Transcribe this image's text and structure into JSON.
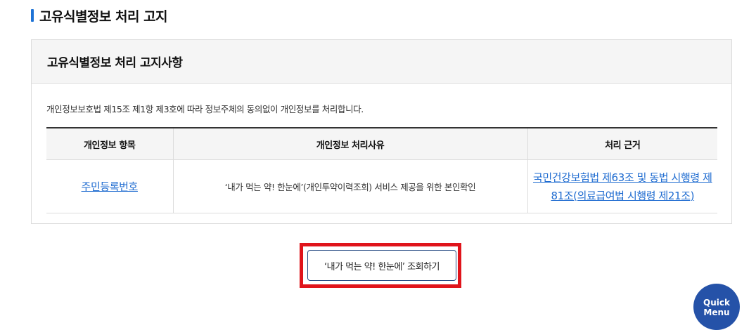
{
  "section": {
    "title": "고유식별정보 처리 고지"
  },
  "panel": {
    "title": "고유식별정보 처리 고지사항",
    "description": "개인정보보호법 제15조 제1항 제3호에 따라 정보주체의 동의없이 개인정보를 처리합니다.",
    "table": {
      "headers": [
        "개인정보 항목",
        "개인정보 처리사유",
        "처리 근거"
      ],
      "rows": [
        {
          "item": "주민등록번호",
          "reason": "‘내가 먹는 약! 한눈에’(개인투약이력조회) 서비스 제공을 위한 본인확인",
          "basis": "국민건강보험법 제63조 및 동법 시행령 제81조(의료급여법 시행령 제21조)"
        }
      ]
    }
  },
  "button": {
    "label": "‘내가 먹는 약! 한눈에’ 조회하기"
  },
  "quick_menu": {
    "line1": "Quick",
    "line2": "Menu"
  },
  "colors": {
    "accent": "#1e73d6",
    "highlight": "#e0141b",
    "link": "#1e6bd0",
    "quick": "#2552a8"
  }
}
